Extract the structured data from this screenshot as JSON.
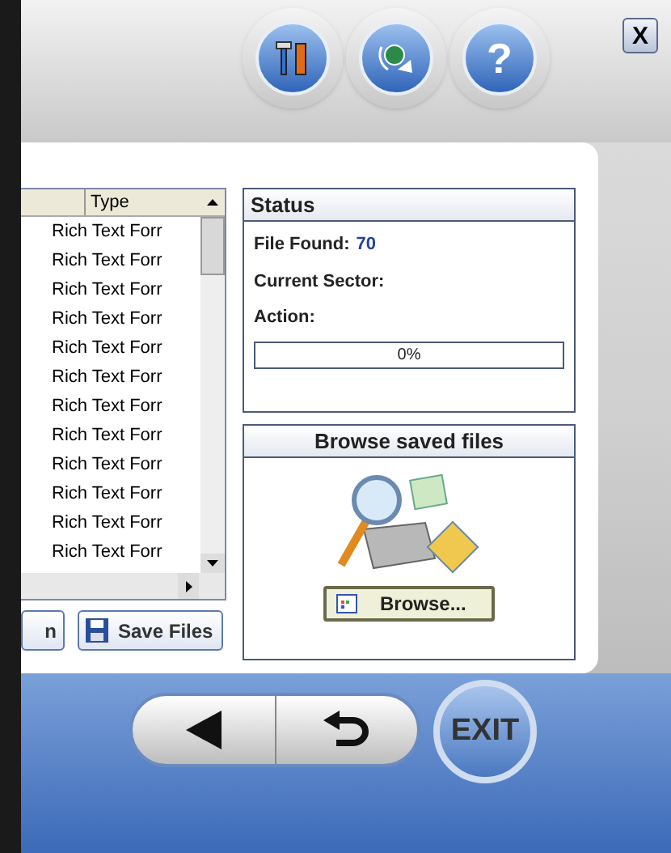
{
  "toolbar": {
    "help_label": "?",
    "close_label": "X"
  },
  "file_table": {
    "columns": [
      "",
      "Type"
    ],
    "rows": [
      [
        "",
        "Rich Text Forr"
      ],
      [
        "",
        "Rich Text Forr"
      ],
      [
        "",
        "Rich Text Forr"
      ],
      [
        "",
        "Rich Text Forr"
      ],
      [
        "",
        "Rich Text Forr"
      ],
      [
        "",
        "Rich Text Forr"
      ],
      [
        "",
        "Rich Text Forr"
      ],
      [
        "",
        "Rich Text Forr"
      ],
      [
        "",
        "Rich Text Forr"
      ],
      [
        "",
        "Rich Text Forr"
      ],
      [
        "",
        "Rich Text Forr"
      ],
      [
        "",
        "Rich Text Forr"
      ]
    ]
  },
  "left_buttons": [
    {
      "label": "n",
      "kind": "plain"
    },
    {
      "label": "Save Files",
      "kind": "save"
    }
  ],
  "status": {
    "title": "Status",
    "file_found_label": "File Found:",
    "file_found_value": "70",
    "sector_label": "Current Sector:",
    "action_label": "Action:",
    "progress": {
      "level": 0,
      "reading": "0%"
    }
  },
  "browse": {
    "title": "Browse saved files",
    "button": "Browse..."
  },
  "nav": {
    "exit_label": "EXIT"
  }
}
